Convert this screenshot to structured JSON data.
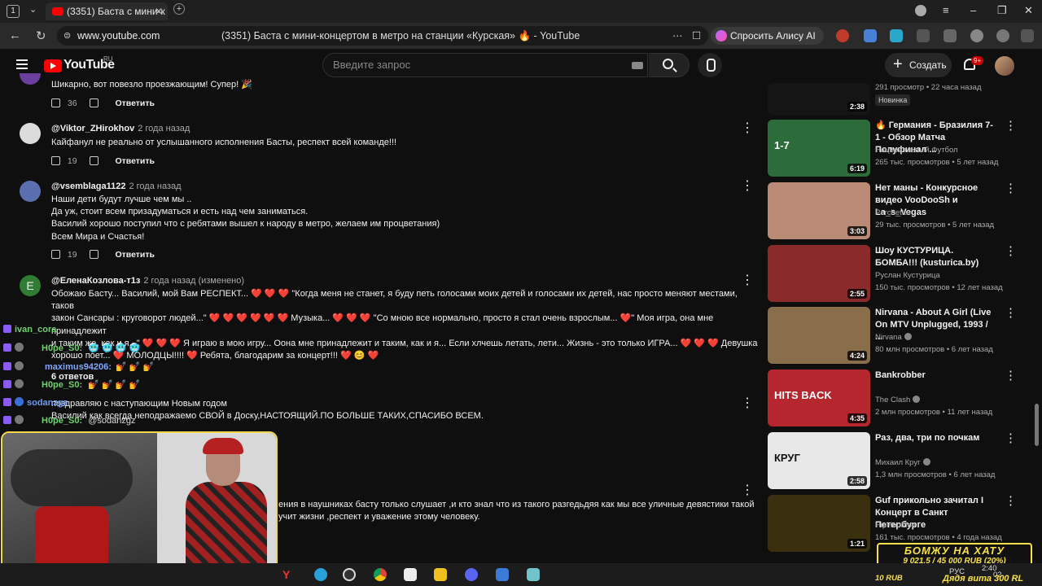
{
  "browser": {
    "tab_count": "1",
    "tab_title": "(3351) Баста с мини-к",
    "url": "www.youtube.com",
    "page_title": "(3351) Баста с мини-концертом в метро на станции «Курская» 🔥 - YouTube",
    "alisa_label": "Спросить Алису AI"
  },
  "yt": {
    "logo": "YouTube",
    "region": "RU",
    "search_placeholder": "Введите запрос",
    "create_label": "Создать",
    "notif_count": "9+"
  },
  "comments": [
    {
      "author": "",
      "time": "",
      "text": "Шикарно, вот повезло проезжающим! Супер! 🎉",
      "likes": "36",
      "reply": "Ответить",
      "color": "#6a3fa0"
    },
    {
      "author": "@Viktor_ZHirokhov",
      "time": "2 года назад",
      "text": "Кайфанул не реально от услышанного исполнения Басты, респект всей команде!!!",
      "likes": "19",
      "reply": "Ответить",
      "color": "#dcdcdc"
    },
    {
      "author": "@vsemblaga1122",
      "time": "2 года назад",
      "text": "Наши дети будут лучше чем мы ..\nДа уж, стоит всем призадуматься и есть над чем заниматься.\nВасилий хорошо поступил что с ребятами вышел к народу в метро, желаем им процветания)\nВсем Мира и Счастья!",
      "likes": "19",
      "reply": "Ответить",
      "color": "#5b6fb0"
    },
    {
      "author": "@ЕленаКозлова-т1з",
      "time": "2 года назад (изменено)",
      "avatar_letter": "E",
      "text": "Обожаю Басту... Василий, мой Вам РЕСПЕКТ... ❤️ ❤️ ❤️ \"Когда меня не станет, я буду петь голосами моих детей и голосами их детей, нас просто меняют местами, таков\nзакон Сансары : круговорот людей...\" ❤️ ❤️ ❤️ ❤️ ❤️ ❤️ Музыка... ❤️ ❤️ ❤️ \"Со мною все нормально, просто я стал очень взрослым... ❤️\" Моя игра, она мне принадлежит\nи таким же, как и я...\" ❤️ ❤️ ❤️ Я играю в мою игру... Оона мне принадлежит и таким, как и я... Если хлчешь летать, лети... Жизнь - это только ИГРА... ❤️ ❤️ ❤️ Девушка\nхорошо поет... ❤️ МОЛОДЦЫ!!!! ❤️ Ребята, благодарим за концерт!!! ❤️ 😊 ❤️",
      "color": "#2e7d32"
    },
    {
      "author": "",
      "time": "",
      "text": "поздравляю с наступающим Новым годом\nВасилий как всегда неподражаемо СВОЙ в Доску,НАСТОЯЩИЙ.ПО БОЛЬШЕ ТАКИХ,СПАСИБО ВСЕМ."
    },
    {
      "author": "",
      "time": "",
      "text": "ения в наушниках басту только слушает ,и кто знал что из такого разгедьдяя как мы все уличные девястики такой\nучит жизни ,респект и уважение этому человеку."
    }
  ],
  "replies_label": "6 ответов",
  "chat": [
    {
      "name": "ivan_cora",
      "text": ""
    },
    {
      "name": "H0pe_S0:",
      "text": "🥶 🥶 🥶 🥶"
    },
    {
      "name": "maximus94206:",
      "text": "💅 💅 💅"
    },
    {
      "name": "H0pe_S0:",
      "text": "💅 💅 💅 💅"
    },
    {
      "name": "sodanzgz",
      "text": "с днём рождения"
    },
    {
      "name": "H0pe_S0:",
      "text": "@sodanzgz"
    }
  ],
  "sidebar": [
    {
      "title": "",
      "channel": "",
      "views": "291 просмотр • 22 часа назад",
      "badge": "Новинка",
      "duration": "2:38",
      "thumb": "#151515"
    },
    {
      "title": "🔥 Германия - Бразилия 7-1 - Обзор Матча Полуфинал ...",
      "channel": "Национальный Футбол",
      "views": "265 тыс. просмотров • 5 лет назад",
      "duration": "6:19",
      "thumb": "#2b6c3a",
      "thumb_text": "1-7"
    },
    {
      "title": "Нет маны - Конкурсное видео VooDooSh и La_s_Vegas",
      "channel": "Perchetta",
      "views": "29 тыс. просмотров • 5 лет назад",
      "duration": "3:03",
      "thumb": "#b98a76"
    },
    {
      "title": "Шоу КУСТУРИЦА. БОМБА!!! (kusturica.by)",
      "channel": "Руслан Кустурица",
      "views": "150 тыс. просмотров • 12 лет назад",
      "duration": "2:55",
      "thumb": "#8a2a2a"
    },
    {
      "title": "Nirvana - About A Girl (Live On MTV Unplugged, 1993 / ...",
      "channel": "Nirvana",
      "views": "80 млн просмотров • 6 лет назад",
      "duration": "4:24",
      "thumb": "#8a6d4a",
      "verified": true
    },
    {
      "title": "Bankrobber",
      "channel": "The Clash",
      "views": "2 млн просмотров • 11 лет назад",
      "duration": "4:35",
      "thumb": "#b5262e",
      "thumb_text": "HITS BACK",
      "verified": true
    },
    {
      "title": "Раз, два, три по почкам",
      "channel": "Михаил Круг",
      "views": "1,3 млн просмотров • 6 лет назад",
      "duration": "2:58",
      "thumb": "#e8e8e8",
      "thumb_text": "КРУГ",
      "verified": true
    },
    {
      "title": "Guf прикольно зачитал I Концерт в Санкт Петербурге",
      "channel": "HipHopMov",
      "views": "161 тыс. просмотров • 4 года назад",
      "duration": "1:21",
      "thumb": "#3a3010"
    }
  ],
  "banner": {
    "title": "БОМЖУ НА ХАТУ",
    "sub": "9 021.5 / 45 000 RUB (20%)",
    "bottom_left": "10 RUB",
    "bottom_right": "Дядя вита 300 RL"
  },
  "taskbar": {
    "lang": "РУС",
    "time": "2:40",
    "date": "02"
  },
  "colors": {
    "bg": "#0f0f0f",
    "accent": "#ff0000",
    "banner": "#f7e04b"
  }
}
